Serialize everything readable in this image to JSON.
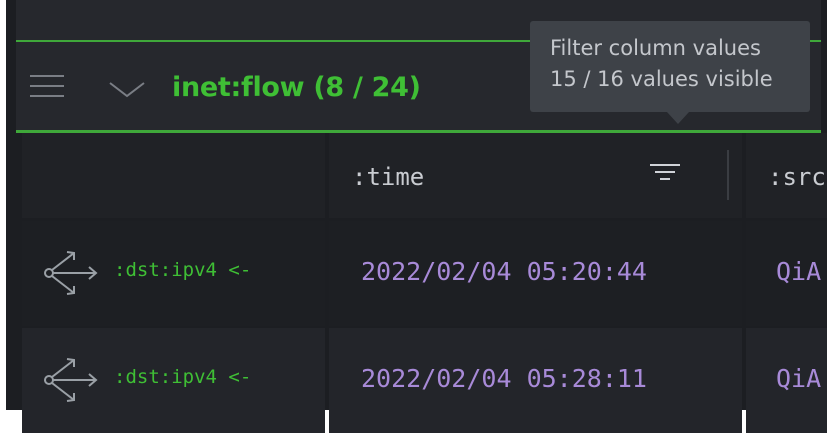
{
  "table": {
    "title": "inet:flow (8 / 24)"
  },
  "tooltip": {
    "line1": "Filter column values",
    "line2": "15 / 16 values visible"
  },
  "columns": [
    {
      "label": ""
    },
    {
      "label": ":time"
    },
    {
      "label": ":src"
    }
  ],
  "rows": [
    {
      "relation": ":dst:ipv4 <-",
      "time": "2022/02/04 05:20:44",
      "src": "QiA"
    },
    {
      "relation": ":dst:ipv4 <-",
      "time": "2022/02/04 05:28:11",
      "src": "QiA"
    }
  ],
  "icons": {
    "menu": "hamburger-menu-icon",
    "chevron": "chevron-down-icon",
    "filter": "filter-icon",
    "fork": "pivot-fork-icon"
  },
  "colors": {
    "accent_green": "#3fbf35",
    "value_purple": "#a88ad8",
    "background": "#1c1e22"
  }
}
